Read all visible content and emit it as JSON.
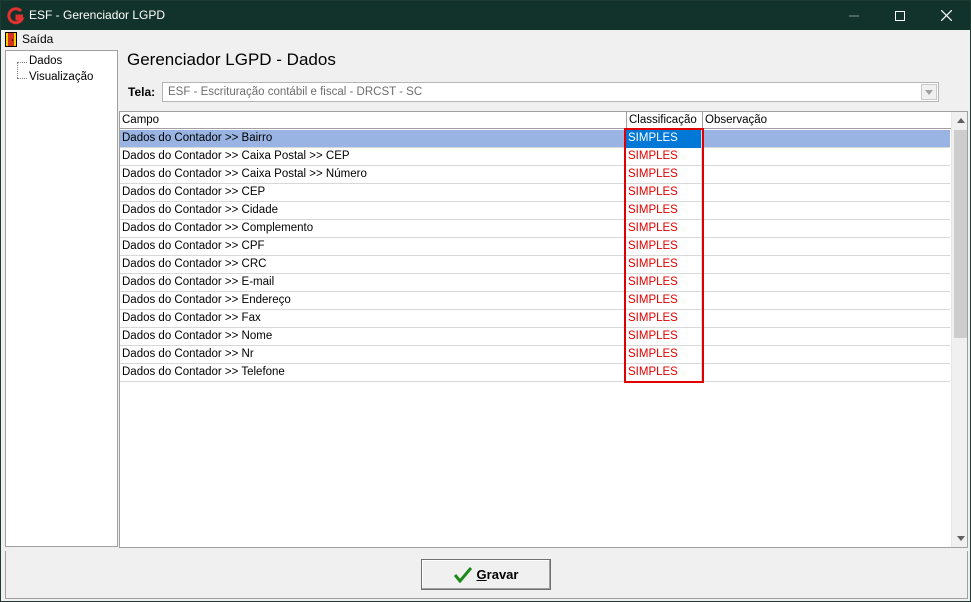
{
  "window": {
    "title": "ESF - Gerenciador LGPD",
    "app_icon": "esf-logo-icon",
    "controls": [
      "minimize-icon",
      "maximize-icon",
      "close-icon"
    ]
  },
  "menu": {
    "items": [
      {
        "label": "Saída",
        "icon": "exit-door-icon"
      }
    ]
  },
  "sidebar": {
    "items": [
      {
        "label": "Dados"
      },
      {
        "label": "Visualização"
      }
    ]
  },
  "main": {
    "title": "Gerenciador LGPD - Dados",
    "tela_label": "Tela:",
    "tela_value": "ESF - Escrituração contábil e fiscal - DRCST - SC"
  },
  "grid": {
    "columns": [
      "Campo",
      "Classificação",
      "Observação"
    ],
    "rows": [
      {
        "campo": "Dados do Contador >> Bairro",
        "classificacao": "SIMPLES",
        "observacao": ""
      },
      {
        "campo": "Dados do Contador >> Caixa Postal >> CEP",
        "classificacao": "SIMPLES",
        "observacao": ""
      },
      {
        "campo": "Dados do Contador >> Caixa Postal >> Número",
        "classificacao": "SIMPLES",
        "observacao": ""
      },
      {
        "campo": "Dados do Contador >> CEP",
        "classificacao": "SIMPLES",
        "observacao": ""
      },
      {
        "campo": "Dados do Contador >> Cidade",
        "classificacao": "SIMPLES",
        "observacao": ""
      },
      {
        "campo": "Dados do Contador >> Complemento",
        "classificacao": "SIMPLES",
        "observacao": ""
      },
      {
        "campo": "Dados do Contador >> CPF",
        "classificacao": "SIMPLES",
        "observacao": ""
      },
      {
        "campo": "Dados do Contador >> CRC",
        "classificacao": "SIMPLES",
        "observacao": ""
      },
      {
        "campo": "Dados do Contador >> E-mail",
        "classificacao": "SIMPLES",
        "observacao": ""
      },
      {
        "campo": "Dados do Contador >> Endereço",
        "classificacao": "SIMPLES",
        "observacao": ""
      },
      {
        "campo": "Dados do Contador >> Fax",
        "classificacao": "SIMPLES",
        "observacao": ""
      },
      {
        "campo": "Dados do Contador >> Nome",
        "classificacao": "SIMPLES",
        "observacao": ""
      },
      {
        "campo": "Dados do Contador >> Nr",
        "classificacao": "SIMPLES",
        "observacao": ""
      },
      {
        "campo": "Dados do Contador >> Telefone",
        "classificacao": "SIMPLES",
        "observacao": ""
      }
    ]
  },
  "footer": {
    "save_label_underlined": "G",
    "save_label_rest": "ravar",
    "save_icon": "checkmark-icon"
  },
  "colors": {
    "titlebar": "#12332b",
    "selection": "#99b4e2",
    "classification_text": "#e00000",
    "highlight_box": "#e00000"
  }
}
